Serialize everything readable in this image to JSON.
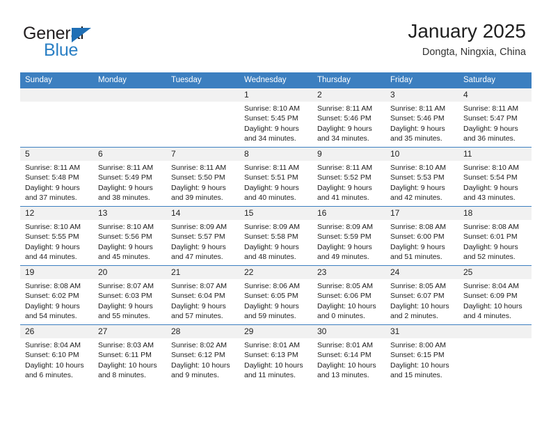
{
  "brand": {
    "name_part1": "General",
    "name_part2": "Blue",
    "triangle_icon": "blue-triangle-logo-mark",
    "color_dark": "#231f20",
    "color_blue": "#2a7fc4"
  },
  "header": {
    "title": "January 2025",
    "location": "Dongta, Ningxia, China"
  },
  "calendar": {
    "header_bg": "#3c7fc0",
    "header_text_color": "#ffffff",
    "daynum_band_bg": "#f1f1f1",
    "weekdays": [
      "Sunday",
      "Monday",
      "Tuesday",
      "Wednesday",
      "Thursday",
      "Friday",
      "Saturday"
    ],
    "weeks": [
      [
        {
          "day": "",
          "sunrise": "",
          "sunset": "",
          "daylight_line1": "",
          "daylight_line2": "",
          "empty": true
        },
        {
          "day": "",
          "sunrise": "",
          "sunset": "",
          "daylight_line1": "",
          "daylight_line2": "",
          "empty": true
        },
        {
          "day": "",
          "sunrise": "",
          "sunset": "",
          "daylight_line1": "",
          "daylight_line2": "",
          "empty": true
        },
        {
          "day": "1",
          "sunrise": "Sunrise: 8:10 AM",
          "sunset": "Sunset: 5:45 PM",
          "daylight_line1": "Daylight: 9 hours",
          "daylight_line2": "and 34 minutes."
        },
        {
          "day": "2",
          "sunrise": "Sunrise: 8:11 AM",
          "sunset": "Sunset: 5:46 PM",
          "daylight_line1": "Daylight: 9 hours",
          "daylight_line2": "and 34 minutes."
        },
        {
          "day": "3",
          "sunrise": "Sunrise: 8:11 AM",
          "sunset": "Sunset: 5:46 PM",
          "daylight_line1": "Daylight: 9 hours",
          "daylight_line2": "and 35 minutes."
        },
        {
          "day": "4",
          "sunrise": "Sunrise: 8:11 AM",
          "sunset": "Sunset: 5:47 PM",
          "daylight_line1": "Daylight: 9 hours",
          "daylight_line2": "and 36 minutes."
        }
      ],
      [
        {
          "day": "5",
          "sunrise": "Sunrise: 8:11 AM",
          "sunset": "Sunset: 5:48 PM",
          "daylight_line1": "Daylight: 9 hours",
          "daylight_line2": "and 37 minutes."
        },
        {
          "day": "6",
          "sunrise": "Sunrise: 8:11 AM",
          "sunset": "Sunset: 5:49 PM",
          "daylight_line1": "Daylight: 9 hours",
          "daylight_line2": "and 38 minutes."
        },
        {
          "day": "7",
          "sunrise": "Sunrise: 8:11 AM",
          "sunset": "Sunset: 5:50 PM",
          "daylight_line1": "Daylight: 9 hours",
          "daylight_line2": "and 39 minutes."
        },
        {
          "day": "8",
          "sunrise": "Sunrise: 8:11 AM",
          "sunset": "Sunset: 5:51 PM",
          "daylight_line1": "Daylight: 9 hours",
          "daylight_line2": "and 40 minutes."
        },
        {
          "day": "9",
          "sunrise": "Sunrise: 8:11 AM",
          "sunset": "Sunset: 5:52 PM",
          "daylight_line1": "Daylight: 9 hours",
          "daylight_line2": "and 41 minutes."
        },
        {
          "day": "10",
          "sunrise": "Sunrise: 8:10 AM",
          "sunset": "Sunset: 5:53 PM",
          "daylight_line1": "Daylight: 9 hours",
          "daylight_line2": "and 42 minutes."
        },
        {
          "day": "11",
          "sunrise": "Sunrise: 8:10 AM",
          "sunset": "Sunset: 5:54 PM",
          "daylight_line1": "Daylight: 9 hours",
          "daylight_line2": "and 43 minutes."
        }
      ],
      [
        {
          "day": "12",
          "sunrise": "Sunrise: 8:10 AM",
          "sunset": "Sunset: 5:55 PM",
          "daylight_line1": "Daylight: 9 hours",
          "daylight_line2": "and 44 minutes."
        },
        {
          "day": "13",
          "sunrise": "Sunrise: 8:10 AM",
          "sunset": "Sunset: 5:56 PM",
          "daylight_line1": "Daylight: 9 hours",
          "daylight_line2": "and 45 minutes."
        },
        {
          "day": "14",
          "sunrise": "Sunrise: 8:09 AM",
          "sunset": "Sunset: 5:57 PM",
          "daylight_line1": "Daylight: 9 hours",
          "daylight_line2": "and 47 minutes."
        },
        {
          "day": "15",
          "sunrise": "Sunrise: 8:09 AM",
          "sunset": "Sunset: 5:58 PM",
          "daylight_line1": "Daylight: 9 hours",
          "daylight_line2": "and 48 minutes."
        },
        {
          "day": "16",
          "sunrise": "Sunrise: 8:09 AM",
          "sunset": "Sunset: 5:59 PM",
          "daylight_line1": "Daylight: 9 hours",
          "daylight_line2": "and 49 minutes."
        },
        {
          "day": "17",
          "sunrise": "Sunrise: 8:08 AM",
          "sunset": "Sunset: 6:00 PM",
          "daylight_line1": "Daylight: 9 hours",
          "daylight_line2": "and 51 minutes."
        },
        {
          "day": "18",
          "sunrise": "Sunrise: 8:08 AM",
          "sunset": "Sunset: 6:01 PM",
          "daylight_line1": "Daylight: 9 hours",
          "daylight_line2": "and 52 minutes."
        }
      ],
      [
        {
          "day": "19",
          "sunrise": "Sunrise: 8:08 AM",
          "sunset": "Sunset: 6:02 PM",
          "daylight_line1": "Daylight: 9 hours",
          "daylight_line2": "and 54 minutes."
        },
        {
          "day": "20",
          "sunrise": "Sunrise: 8:07 AM",
          "sunset": "Sunset: 6:03 PM",
          "daylight_line1": "Daylight: 9 hours",
          "daylight_line2": "and 55 minutes."
        },
        {
          "day": "21",
          "sunrise": "Sunrise: 8:07 AM",
          "sunset": "Sunset: 6:04 PM",
          "daylight_line1": "Daylight: 9 hours",
          "daylight_line2": "and 57 minutes."
        },
        {
          "day": "22",
          "sunrise": "Sunrise: 8:06 AM",
          "sunset": "Sunset: 6:05 PM",
          "daylight_line1": "Daylight: 9 hours",
          "daylight_line2": "and 59 minutes."
        },
        {
          "day": "23",
          "sunrise": "Sunrise: 8:05 AM",
          "sunset": "Sunset: 6:06 PM",
          "daylight_line1": "Daylight: 10 hours",
          "daylight_line2": "and 0 minutes."
        },
        {
          "day": "24",
          "sunrise": "Sunrise: 8:05 AM",
          "sunset": "Sunset: 6:07 PM",
          "daylight_line1": "Daylight: 10 hours",
          "daylight_line2": "and 2 minutes."
        },
        {
          "day": "25",
          "sunrise": "Sunrise: 8:04 AM",
          "sunset": "Sunset: 6:09 PM",
          "daylight_line1": "Daylight: 10 hours",
          "daylight_line2": "and 4 minutes."
        }
      ],
      [
        {
          "day": "26",
          "sunrise": "Sunrise: 8:04 AM",
          "sunset": "Sunset: 6:10 PM",
          "daylight_line1": "Daylight: 10 hours",
          "daylight_line2": "and 6 minutes."
        },
        {
          "day": "27",
          "sunrise": "Sunrise: 8:03 AM",
          "sunset": "Sunset: 6:11 PM",
          "daylight_line1": "Daylight: 10 hours",
          "daylight_line2": "and 8 minutes."
        },
        {
          "day": "28",
          "sunrise": "Sunrise: 8:02 AM",
          "sunset": "Sunset: 6:12 PM",
          "daylight_line1": "Daylight: 10 hours",
          "daylight_line2": "and 9 minutes."
        },
        {
          "day": "29",
          "sunrise": "Sunrise: 8:01 AM",
          "sunset": "Sunset: 6:13 PM",
          "daylight_line1": "Daylight: 10 hours",
          "daylight_line2": "and 11 minutes."
        },
        {
          "day": "30",
          "sunrise": "Sunrise: 8:01 AM",
          "sunset": "Sunset: 6:14 PM",
          "daylight_line1": "Daylight: 10 hours",
          "daylight_line2": "and 13 minutes."
        },
        {
          "day": "31",
          "sunrise": "Sunrise: 8:00 AM",
          "sunset": "Sunset: 6:15 PM",
          "daylight_line1": "Daylight: 10 hours",
          "daylight_line2": "and 15 minutes."
        },
        {
          "day": "",
          "sunrise": "",
          "sunset": "",
          "daylight_line1": "",
          "daylight_line2": "",
          "empty": true
        }
      ]
    ]
  }
}
